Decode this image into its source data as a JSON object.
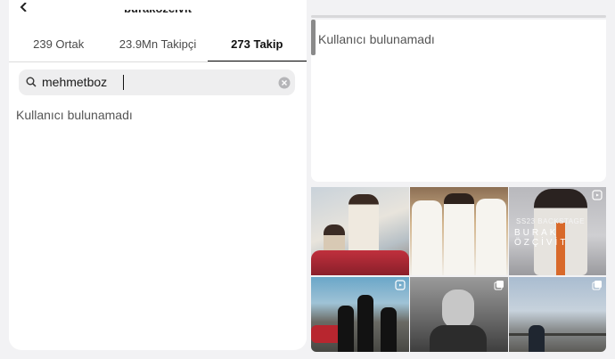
{
  "header": {
    "title": "burakozcivit"
  },
  "tabs": [
    {
      "label": "239 Ortak",
      "active": false
    },
    {
      "label": "23.9Mn Takipçi",
      "active": false
    },
    {
      "label": "273 Takip",
      "active": true
    }
  ],
  "search": {
    "value": "mehmetboz"
  },
  "left_panel": {
    "empty_message": "Kullanıcı bulunamadı"
  },
  "right_panel": {
    "empty_message": "Kullanıcı bulunamadı",
    "posts": [
      {
        "media_icon": "none"
      },
      {
        "media_icon": "none"
      },
      {
        "media_icon": "reels-icon",
        "caption_line1": "SS23 BACKSTAGE",
        "caption_line2": "BURAK ÖZÇİVİT"
      },
      {
        "media_icon": "reels-icon"
      },
      {
        "media_icon": "carousel-icon"
      },
      {
        "media_icon": "carousel-icon"
      }
    ]
  },
  "colors": {
    "active_tab": "#111111",
    "search_bg": "#eeeeef",
    "panel_bg": "#ffffff",
    "page_bg": "#f2f2f4"
  }
}
